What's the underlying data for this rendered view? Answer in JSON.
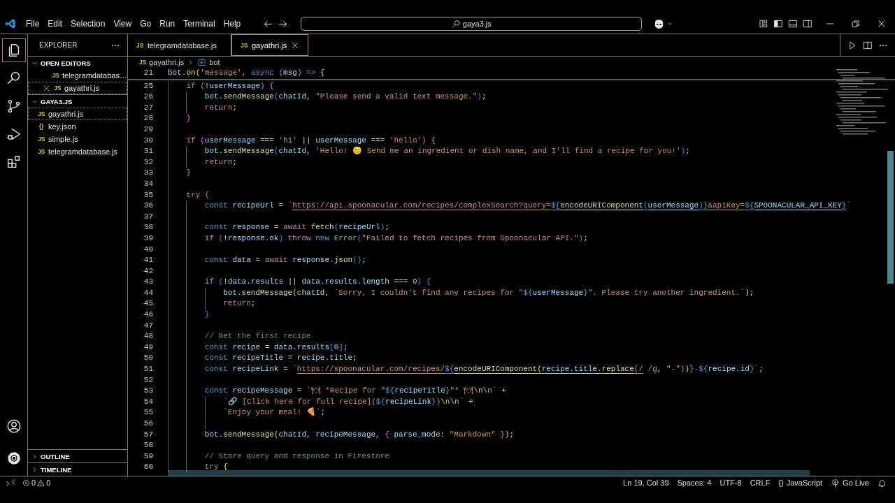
{
  "title_bar": {
    "menu": [
      "File",
      "Edit",
      "Selection",
      "View",
      "Go",
      "Run",
      "Terminal",
      "Help"
    ],
    "search": {
      "value": "gaya3.js"
    }
  },
  "activity_bar": {
    "items": [
      {
        "kind": "files",
        "selected": true
      },
      {
        "kind": "search",
        "selected": false
      },
      {
        "kind": "source-control",
        "selected": false
      },
      {
        "kind": "run-debug",
        "selected": false
      },
      {
        "kind": "extensions",
        "selected": false
      }
    ],
    "bottom": [
      {
        "kind": "account"
      },
      {
        "kind": "settings"
      }
    ]
  },
  "sidebar": {
    "title": "EXPLORER",
    "sections": [
      {
        "title": "OPEN EDITORS",
        "expanded": true,
        "indented": true,
        "items": [
          {
            "icon_text": "JS",
            "label": "telegramdatabas…",
            "selected": false,
            "closable": false
          },
          {
            "icon_text": "JS",
            "label": "gayathri.js",
            "selected": true,
            "closable": true
          }
        ]
      },
      {
        "title": "GAYA3.JS",
        "expanded": true,
        "indented": false,
        "items": [
          {
            "icon_text": "JS",
            "label": "gayathri.js",
            "selected": true,
            "closable": false
          },
          {
            "icon_text": "{}",
            "label": "key.json",
            "selected": false,
            "closable": false
          },
          {
            "icon_text": "JS",
            "label": "simple.js",
            "selected": false,
            "closable": false
          },
          {
            "icon_text": "JS",
            "label": "telegramdatabase.js",
            "selected": false,
            "closable": false
          }
        ]
      }
    ],
    "footer_sections": [
      {
        "title": "OUTLINE",
        "expanded": false
      },
      {
        "title": "TIMELINE",
        "expanded": false
      }
    ]
  },
  "editor": {
    "tabs": [
      {
        "icon_text": "JS",
        "label": "telegramdatabase.js",
        "selected": false
      },
      {
        "icon_text": "JS",
        "label": "gayathri.js",
        "selected": true
      }
    ],
    "breadcrumb": [
      {
        "kind": "file",
        "icon_text": "JS",
        "label": "gayathri.js"
      },
      {
        "kind": "symbol",
        "label": "bot"
      }
    ],
    "sticky_lines": [
      {
        "number": "21",
        "segments": [
          {
            "text": "bot",
            "kind": "v"
          },
          {
            "text": ".",
            "kind": "p"
          },
          {
            "text": "on",
            "kind": "fn"
          },
          {
            "text": "(",
            "kind": "b1"
          },
          {
            "text": "'message'",
            "kind": "s"
          },
          {
            "text": ", ",
            "kind": "p"
          },
          {
            "text": "async",
            "kind": "st"
          },
          {
            "text": " (",
            "kind": "b2"
          },
          {
            "text": "msg",
            "kind": "v"
          },
          {
            "text": ")",
            "kind": "b2"
          },
          {
            "text": " => ",
            "kind": "st"
          },
          {
            "text": "{",
            "kind": "b1"
          }
        ]
      }
    ],
    "lines": [
      {
        "number": "25",
        "segments": [
          {
            "text": "    if",
            "kind": "kw"
          },
          {
            "text": " (",
            "kind": "b2"
          },
          {
            "text": "!",
            "kind": "p"
          },
          {
            "text": "userMessage",
            "kind": "v"
          },
          {
            "text": ")",
            "kind": "b2"
          },
          {
            "text": " {",
            "kind": "b2"
          }
        ]
      },
      {
        "number": "26",
        "segments": [
          {
            "text": "        bot",
            "kind": "v"
          },
          {
            "text": ".",
            "kind": "p"
          },
          {
            "text": "sendMessage",
            "kind": "fn"
          },
          {
            "text": "(",
            "kind": "b3"
          },
          {
            "text": "chatId",
            "kind": "v"
          },
          {
            "text": ", ",
            "kind": "p"
          },
          {
            "text": "\"Please send a valid text message.\"",
            "kind": "s"
          },
          {
            "text": ")",
            "kind": "b3"
          },
          {
            "text": ";",
            "kind": "p"
          }
        ]
      },
      {
        "number": "27",
        "segments": [
          {
            "text": "        return",
            "kind": "kw"
          },
          {
            "text": ";",
            "kind": "p"
          }
        ]
      },
      {
        "number": "28",
        "segments": [
          {
            "text": "    }",
            "kind": "b2"
          }
        ]
      },
      {
        "number": "29"
      },
      {
        "number": "30",
        "segments": [
          {
            "text": "    if",
            "kind": "kw"
          },
          {
            "text": " (",
            "kind": "b2"
          },
          {
            "text": "userMessage",
            "kind": "v"
          },
          {
            "text": " === ",
            "kind": "p"
          },
          {
            "text": "'hi'",
            "kind": "s"
          },
          {
            "text": " || ",
            "kind": "p"
          },
          {
            "text": "userMessage",
            "kind": "v"
          },
          {
            "text": " === ",
            "kind": "p"
          },
          {
            "text": "'hello'",
            "kind": "s"
          },
          {
            "text": ")",
            "kind": "b2"
          },
          {
            "text": " {",
            "kind": "b2"
          }
        ]
      },
      {
        "number": "31",
        "segments": [
          {
            "text": "        bot",
            "kind": "v"
          },
          {
            "text": ".",
            "kind": "p"
          },
          {
            "text": "sendMessage",
            "kind": "fn"
          },
          {
            "text": "(",
            "kind": "b3"
          },
          {
            "text": "chatId",
            "kind": "v"
          },
          {
            "text": ", ",
            "kind": "p"
          },
          {
            "text": "'Hello! 😊 Send me an ingredient or dish name, and I'll find a recipe for you!'",
            "kind": "s"
          },
          {
            "text": ")",
            "kind": "b3"
          },
          {
            "text": ";",
            "kind": "p"
          }
        ]
      },
      {
        "number": "32",
        "segments": [
          {
            "text": "        return",
            "kind": "kw"
          },
          {
            "text": ";",
            "kind": "p"
          }
        ]
      },
      {
        "number": "33",
        "segments": [
          {
            "text": "    }",
            "kind": "b2"
          }
        ]
      },
      {
        "number": "34"
      },
      {
        "number": "35",
        "segments": [
          {
            "text": "    try",
            "kind": "kw"
          },
          {
            "text": " {",
            "kind": "b2"
          }
        ]
      },
      {
        "number": "36",
        "segments": [
          {
            "text": "        const",
            "kind": "st"
          },
          {
            "text": " recipeUrl",
            "kind": "v"
          },
          {
            "text": " = ",
            "kind": "p"
          },
          {
            "text": "`",
            "kind": "s"
          },
          {
            "text": "https://api.spoonacular.com/recipes/complexSearch?query=",
            "kind": "s",
            "underline": true
          },
          {
            "text": "${",
            "kind": "st",
            "underline": true
          },
          {
            "text": "encodeURIComponent",
            "kind": "fn",
            "underline": true
          },
          {
            "text": "(",
            "kind": "b3",
            "underline": true
          },
          {
            "text": "userMessage",
            "kind": "v",
            "underline": true
          },
          {
            "text": ")",
            "kind": "b3",
            "underline": true
          },
          {
            "text": "}",
            "kind": "st",
            "underline": true
          },
          {
            "text": "&apiKey=",
            "kind": "s",
            "underline": true
          },
          {
            "text": "${",
            "kind": "st",
            "underline": true
          },
          {
            "text": "SPOONACULAR_API_KEY",
            "kind": "v",
            "underline": true
          },
          {
            "text": "}",
            "kind": "st",
            "underline": true
          },
          {
            "text": "`",
            "kind": "s"
          }
        ]
      },
      {
        "number": "37"
      },
      {
        "number": "38",
        "segments": [
          {
            "text": "        const",
            "kind": "st"
          },
          {
            "text": " response",
            "kind": "v"
          },
          {
            "text": " = ",
            "kind": "p"
          },
          {
            "text": "await",
            "kind": "kw"
          },
          {
            "text": " fetch",
            "kind": "fn"
          },
          {
            "text": "(",
            "kind": "b3"
          },
          {
            "text": "recipeUrl",
            "kind": "v"
          },
          {
            "text": ")",
            "kind": "b3"
          },
          {
            "text": ";",
            "kind": "p"
          }
        ]
      },
      {
        "number": "39",
        "segments": [
          {
            "text": "        if",
            "kind": "kw"
          },
          {
            "text": " (",
            "kind": "b3"
          },
          {
            "text": "!",
            "kind": "p"
          },
          {
            "text": "response",
            "kind": "v"
          },
          {
            "text": ".",
            "kind": "p"
          },
          {
            "text": "ok",
            "kind": "v"
          },
          {
            "text": ")",
            "kind": "b3"
          },
          {
            "text": " throw",
            "kind": "kw"
          },
          {
            "text": " new",
            "kind": "st"
          },
          {
            "text": " Error",
            "kind": "t"
          },
          {
            "text": "(",
            "kind": "b3"
          },
          {
            "text": "\"Failed to fetch recipes from Spoonacular API.\"",
            "kind": "s"
          },
          {
            "text": ")",
            "kind": "b3"
          },
          {
            "text": ";",
            "kind": "p"
          }
        ]
      },
      {
        "number": "40"
      },
      {
        "number": "41",
        "segments": [
          {
            "text": "        const",
            "kind": "st"
          },
          {
            "text": " data",
            "kind": "v"
          },
          {
            "text": " = ",
            "kind": "p"
          },
          {
            "text": "await",
            "kind": "kw"
          },
          {
            "text": " response",
            "kind": "v"
          },
          {
            "text": ".",
            "kind": "p"
          },
          {
            "text": "json",
            "kind": "fn"
          },
          {
            "text": "()",
            "kind": "b3"
          },
          {
            "text": ";",
            "kind": "p"
          }
        ]
      },
      {
        "number": "42"
      },
      {
        "number": "43",
        "segments": [
          {
            "text": "        if",
            "kind": "kw"
          },
          {
            "text": " (",
            "kind": "b3"
          },
          {
            "text": "!",
            "kind": "p"
          },
          {
            "text": "data",
            "kind": "v"
          },
          {
            "text": ".",
            "kind": "p"
          },
          {
            "text": "results",
            "kind": "v"
          },
          {
            "text": " || ",
            "kind": "p"
          },
          {
            "text": "data",
            "kind": "v"
          },
          {
            "text": ".",
            "kind": "p"
          },
          {
            "text": "results",
            "kind": "v"
          },
          {
            "text": ".",
            "kind": "p"
          },
          {
            "text": "length",
            "kind": "v"
          },
          {
            "text": " === ",
            "kind": "p"
          },
          {
            "text": "0",
            "kind": "n"
          },
          {
            "text": ")",
            "kind": "b3"
          },
          {
            "text": " {",
            "kind": "b3"
          }
        ]
      },
      {
        "number": "44",
        "segments": [
          {
            "text": "            bot",
            "kind": "v"
          },
          {
            "text": ".",
            "kind": "p"
          },
          {
            "text": "sendMessage",
            "kind": "fn"
          },
          {
            "text": "(",
            "kind": "b1"
          },
          {
            "text": "chatId",
            "kind": "v"
          },
          {
            "text": ", ",
            "kind": "p"
          },
          {
            "text": "`Sorry, I couldn't find any recipes for \"",
            "kind": "s"
          },
          {
            "text": "${",
            "kind": "st"
          },
          {
            "text": "userMessage",
            "kind": "v"
          },
          {
            "text": "}",
            "kind": "st"
          },
          {
            "text": "\". Please try another ingredient.`",
            "kind": "s"
          },
          {
            "text": ")",
            "kind": "b1"
          },
          {
            "text": ";",
            "kind": "p"
          }
        ]
      },
      {
        "number": "45",
        "segments": [
          {
            "text": "            return",
            "kind": "kw"
          },
          {
            "text": ";",
            "kind": "p"
          }
        ]
      },
      {
        "number": "46",
        "segments": [
          {
            "text": "        }",
            "kind": "b3"
          }
        ]
      },
      {
        "number": "47"
      },
      {
        "number": "48",
        "segments": [
          {
            "text": "        // Get the first recipe",
            "kind": "c"
          }
        ]
      },
      {
        "number": "49",
        "segments": [
          {
            "text": "        const",
            "kind": "st"
          },
          {
            "text": " recipe",
            "kind": "v"
          },
          {
            "text": " = ",
            "kind": "p"
          },
          {
            "text": "data",
            "kind": "v"
          },
          {
            "text": ".",
            "kind": "p"
          },
          {
            "text": "results",
            "kind": "v"
          },
          {
            "text": "[",
            "kind": "b3"
          },
          {
            "text": "0",
            "kind": "n"
          },
          {
            "text": "]",
            "kind": "b3"
          },
          {
            "text": ";",
            "kind": "p"
          }
        ]
      },
      {
        "number": "50",
        "segments": [
          {
            "text": "        const",
            "kind": "st"
          },
          {
            "text": " recipeTitle",
            "kind": "v"
          },
          {
            "text": " = ",
            "kind": "p"
          },
          {
            "text": "recipe",
            "kind": "v"
          },
          {
            "text": ".",
            "kind": "p"
          },
          {
            "text": "title",
            "kind": "v"
          },
          {
            "text": ";",
            "kind": "p"
          }
        ]
      },
      {
        "number": "51",
        "segments": [
          {
            "text": "        const",
            "kind": "st"
          },
          {
            "text": " recipeLink",
            "kind": "v"
          },
          {
            "text": " = ",
            "kind": "p"
          },
          {
            "text": "`",
            "kind": "s"
          },
          {
            "text": "https://spoonacular.com/recipes/",
            "kind": "s",
            "underline": true
          },
          {
            "text": "${",
            "kind": "st",
            "underline": true
          },
          {
            "text": "encodeURIComponent",
            "kind": "fn",
            "underline": true
          },
          {
            "text": "(",
            "kind": "b1",
            "underline": true
          },
          {
            "text": "recipe",
            "kind": "v",
            "underline": true
          },
          {
            "text": ".",
            "kind": "p",
            "underline": true
          },
          {
            "text": "title",
            "kind": "v",
            "underline": true
          },
          {
            "text": ".",
            "kind": "p",
            "underline": true
          },
          {
            "text": "replace",
            "kind": "fn",
            "underline": true
          },
          {
            "text": "(",
            "kind": "b2",
            "underline": true
          },
          {
            "text": "/",
            "kind": "s",
            "underline": true
          },
          {
            "text": " /g",
            "kind": "s"
          },
          {
            "text": ", ",
            "kind": "p"
          },
          {
            "text": "\"-\"",
            "kind": "s"
          },
          {
            "text": ")",
            "kind": "b2"
          },
          {
            "text": ")",
            "kind": "b1"
          },
          {
            "text": "}",
            "kind": "st"
          },
          {
            "text": "-",
            "kind": "s"
          },
          {
            "text": "${",
            "kind": "st"
          },
          {
            "text": "recipe",
            "kind": "v"
          },
          {
            "text": ".",
            "kind": "p"
          },
          {
            "text": "id",
            "kind": "v"
          },
          {
            "text": "}",
            "kind": "st"
          },
          {
            "text": "`",
            "kind": "s"
          },
          {
            "text": ";",
            "kind": "p"
          }
        ]
      },
      {
        "number": "52"
      },
      {
        "number": "53",
        "segments": [
          {
            "text": "        const",
            "kind": "st"
          },
          {
            "text": " recipeMessage",
            "kind": "v"
          },
          {
            "text": " = ",
            "kind": "p"
          },
          {
            "text": "`🍽 *Recipe for \"",
            "kind": "s"
          },
          {
            "text": "${",
            "kind": "st"
          },
          {
            "text": "recipeTitle",
            "kind": "v"
          },
          {
            "text": "}",
            "kind": "st"
          },
          {
            "text": "\"* 🍽",
            "kind": "s"
          },
          {
            "text": "\\n\\n",
            "kind": "esc"
          },
          {
            "text": "`",
            "kind": "s"
          },
          {
            "text": " +",
            "kind": "p"
          }
        ]
      },
      {
        "number": "54",
        "segments": [
          {
            "text": "            `🔗 [Click here for full recipe](",
            "kind": "s"
          },
          {
            "text": "${",
            "kind": "st"
          },
          {
            "text": "recipeLink",
            "kind": "v"
          },
          {
            "text": "}",
            "kind": "st"
          },
          {
            "text": ")",
            "kind": "s"
          },
          {
            "text": "\\n\\n",
            "kind": "esc"
          },
          {
            "text": "`",
            "kind": "s"
          },
          {
            "text": " +",
            "kind": "p"
          }
        ]
      },
      {
        "number": "55",
        "segments": [
          {
            "text": "            `Enjoy your meal! 🍕`",
            "kind": "s"
          },
          {
            "text": ";",
            "kind": "p"
          }
        ]
      },
      {
        "number": "56"
      },
      {
        "number": "57",
        "segments": [
          {
            "text": "        bot",
            "kind": "v"
          },
          {
            "text": ".",
            "kind": "p"
          },
          {
            "text": "sendMessage",
            "kind": "fn"
          },
          {
            "text": "(",
            "kind": "b1"
          },
          {
            "text": "chatId",
            "kind": "v"
          },
          {
            "text": ", ",
            "kind": "p"
          },
          {
            "text": "recipeMessage",
            "kind": "v"
          },
          {
            "text": ", ",
            "kind": "p"
          },
          {
            "text": "{ ",
            "kind": "b2"
          },
          {
            "text": "parse_mode",
            "kind": "v"
          },
          {
            "text": ": ",
            "kind": "p"
          },
          {
            "text": "\"Markdown\"",
            "kind": "s"
          },
          {
            "text": " }",
            "kind": "b2"
          },
          {
            "text": ")",
            "kind": "b1"
          },
          {
            "text": ";",
            "kind": "p"
          }
        ]
      },
      {
        "number": "58"
      },
      {
        "number": "59",
        "segments": [
          {
            "text": "        // Store query and response in Firestore",
            "kind": "c"
          }
        ]
      },
      {
        "number": "60",
        "segments": [
          {
            "text": "        try",
            "kind": "kw"
          },
          {
            "text": " {",
            "kind": "b1"
          }
        ]
      }
    ]
  },
  "status_bar": {
    "problems": {
      "errors": "0",
      "warnings": "0"
    },
    "items": [
      {
        "kind": "text",
        "label": "Ln 19, Col 39"
      },
      {
        "kind": "text",
        "label": "Spaces: 4"
      },
      {
        "kind": "text",
        "label": "UTF-8"
      },
      {
        "kind": "text",
        "label": "CRLF"
      },
      {
        "kind": "language",
        "icon_text": "{}",
        "label": "JavaScript"
      },
      {
        "kind": "golive",
        "label": "Go Live"
      },
      {
        "kind": "bell"
      }
    ]
  }
}
